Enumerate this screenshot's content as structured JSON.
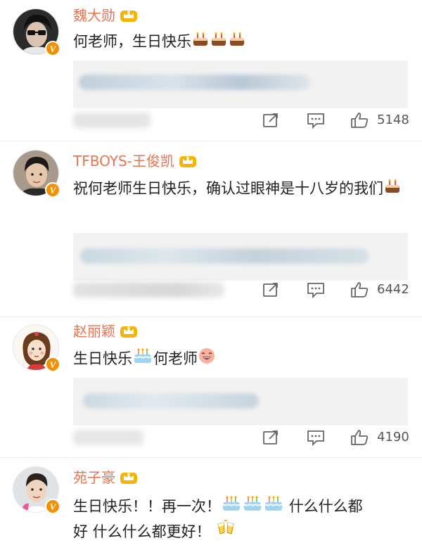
{
  "colors": {
    "username": "#eb7350",
    "text": "#222222",
    "badge": "#f29100",
    "reply_bg": "#f2f2f2",
    "icon": "#666666"
  },
  "comments": [
    {
      "username": "魏大勋",
      "text": "何老师，生日快乐",
      "emojis": [
        "cake-icon",
        "cake-icon",
        "cake-icon"
      ],
      "like_count": "5148"
    },
    {
      "username": "TFBOYS-王俊凯",
      "text": "祝何老师生日快乐，确认过眼神是十八岁的我们",
      "emojis": [
        "cake-icon"
      ],
      "like_count": "6442"
    },
    {
      "username": "赵丽颖",
      "text_before": "生日快乐",
      "text_after": "何老师",
      "emojis": [
        "birthday-cake-icon",
        "laughing-face-icon"
      ],
      "like_count": "4190"
    },
    {
      "username": "苑子豪",
      "text_line1_a": "生日快乐！！再一次！",
      "text_line1_b": "什么什么都",
      "text_line2": "好 什么什么都更好！",
      "emojis": [
        "birthday-cake-icon",
        "birthday-cake-icon",
        "birthday-cake-icon",
        "cheers-icon"
      ]
    }
  ]
}
